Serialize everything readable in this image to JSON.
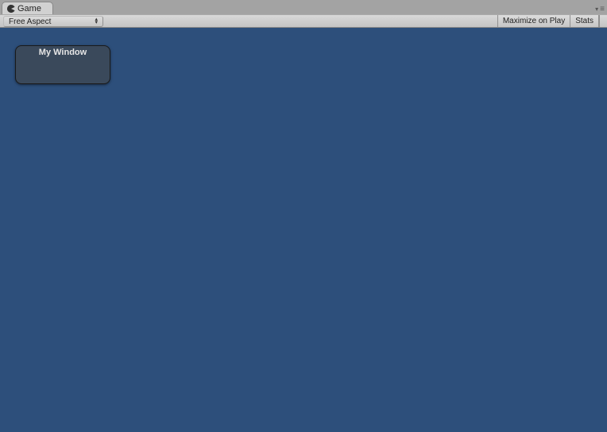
{
  "tab": {
    "label": "Game"
  },
  "toolbar": {
    "aspect_dropdown": "Free Aspect",
    "maximize_label": "Maximize on Play",
    "stats_label": "Stats"
  },
  "gui_window": {
    "title": "My Window"
  }
}
